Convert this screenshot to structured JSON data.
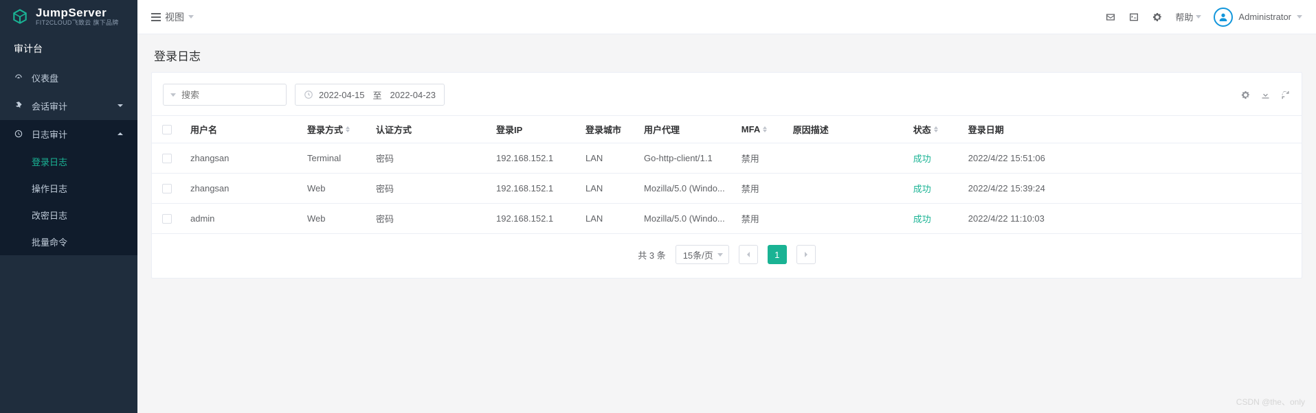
{
  "brand": {
    "title": "JumpServer",
    "subtitle": "FIT2CLOUD飞致云 旗下品牌"
  },
  "sidebar": {
    "section": "审计台",
    "items": [
      {
        "label": "仪表盘"
      },
      {
        "label": "会话审计"
      },
      {
        "label": "日志审计"
      }
    ],
    "log_submenu": [
      {
        "label": "登录日志"
      },
      {
        "label": "操作日志"
      },
      {
        "label": "改密日志"
      },
      {
        "label": "批量命令"
      }
    ]
  },
  "topbar": {
    "view": "视图",
    "help": "帮助",
    "user": "Administrator"
  },
  "page": {
    "title": "登录日志"
  },
  "search": {
    "placeholder": "搜索"
  },
  "date": {
    "from": "2022-04-15",
    "sep": "至",
    "to": "2022-04-23"
  },
  "table": {
    "headers": {
      "username": "用户名",
      "login_method": "登录方式",
      "auth_method": "认证方式",
      "login_ip": "登录IP",
      "login_city": "登录城市",
      "user_agent": "用户代理",
      "mfa": "MFA",
      "reason": "原因描述",
      "status": "状态",
      "login_date": "登录日期"
    },
    "rows": [
      {
        "username": "zhangsan",
        "login_method": "Terminal",
        "auth_method": "密码",
        "login_ip": "192.168.152.1",
        "login_city": "LAN",
        "user_agent": "Go-http-client/1.1",
        "mfa": "禁用",
        "reason": "",
        "status": "成功",
        "login_date": "2022/4/22 15:51:06"
      },
      {
        "username": "zhangsan",
        "login_method": "Web",
        "auth_method": "密码",
        "login_ip": "192.168.152.1",
        "login_city": "LAN",
        "user_agent": "Mozilla/5.0 (Windo...",
        "mfa": "禁用",
        "reason": "",
        "status": "成功",
        "login_date": "2022/4/22 15:39:24"
      },
      {
        "username": "admin",
        "login_method": "Web",
        "auth_method": "密码",
        "login_ip": "192.168.152.1",
        "login_city": "LAN",
        "user_agent": "Mozilla/5.0 (Windo...",
        "mfa": "禁用",
        "reason": "",
        "status": "成功",
        "login_date": "2022/4/22 11:10:03"
      }
    ]
  },
  "pagination": {
    "total": "共 3 条",
    "page_size": "15条/页",
    "current": "1"
  },
  "watermark": "CSDN @the、only"
}
